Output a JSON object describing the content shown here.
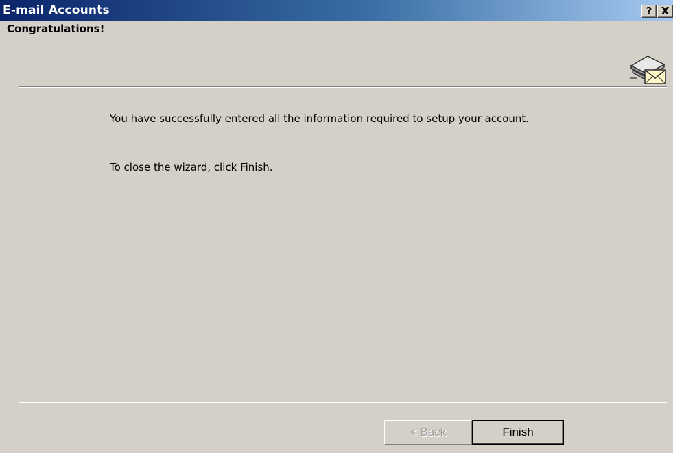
{
  "window": {
    "title": "E-mail Accounts",
    "help_label": "?",
    "close_label": "X"
  },
  "header": {
    "title": "Congratulations!",
    "icon": "mail-account-icon"
  },
  "body": {
    "message1": "You have successfully entered all the information required to setup your account.",
    "message2": "To close the wizard, click Finish."
  },
  "buttons": {
    "back_label": "< Back",
    "finish_label": "Finish"
  },
  "colors": {
    "titlebar_start": "#0a246a",
    "titlebar_end": "#a6caf0",
    "dialog_background": "#d4d0c8"
  }
}
